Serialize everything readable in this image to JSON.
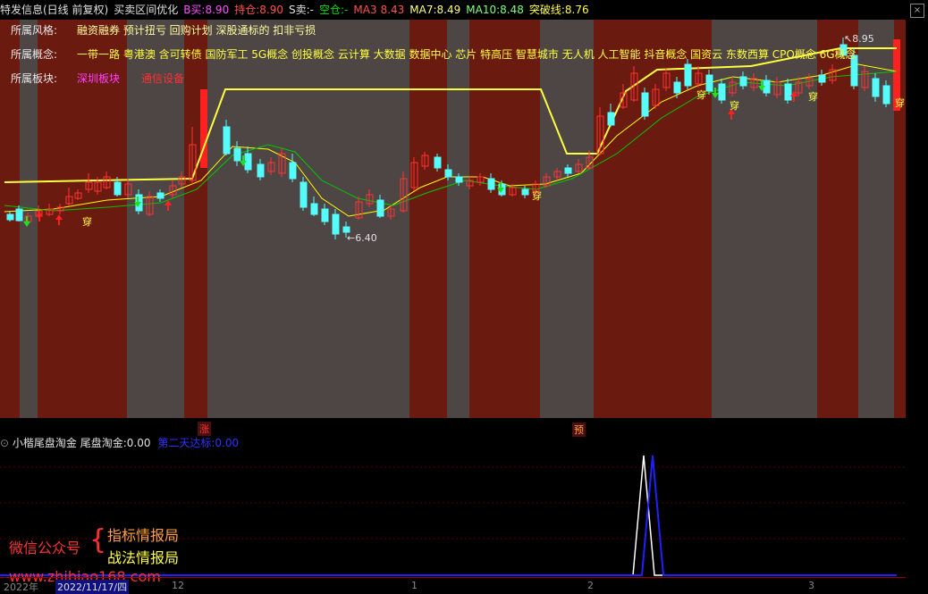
{
  "header": {
    "title": "特发信息(日线 前复权)",
    "indicator": "买卖区间优化",
    "b_buy_label": "B买:",
    "b_buy_value": "8.90",
    "hold_label": "持仓:",
    "hold_value": "8.90",
    "s_sell_label": "S卖:",
    "s_sell_value": "-",
    "empty_label": "空仓:",
    "empty_value": "-",
    "ma3_label": "MA3",
    "ma3_value": "8.43",
    "ma7_label": "MA7:",
    "ma7_value": "8.49",
    "ma10_label": "MA10:",
    "ma10_value": "8.48",
    "breakout_label": "突破线:",
    "breakout_value": "8.76",
    "close_symbol": "×"
  },
  "info": {
    "style_label": "所属风格:",
    "style_value": "融资融券 预计扭亏 回购计划 深股通标的 扣非亏损",
    "concept_label": "所属概念:",
    "concept_value": "一带一路 粤港澳 含可转债 国防军工 5G概念 创投概念 云计算 大数据 数据中心 芯片 特高压 智慧城市 无人机 人工智能 抖音概念 国资云 东数西算 CPO概念 6G概念",
    "sector_label": "所属板块:",
    "sector_value1": "深圳板块",
    "sector_value2": "通信设备"
  },
  "annotations": {
    "high": "8.95",
    "low": "6.40",
    "chuan": "穿",
    "zhang": "涨",
    "yu": "预"
  },
  "sub": {
    "name": "小楷尾盘淘金",
    "t1_label": "尾盘淘金:",
    "t1_value": "0.00",
    "t2_label": "第二天达标:",
    "t2_value": "0.00"
  },
  "watermark": {
    "wechat": "微信公众号",
    "line1": "指标情报局",
    "line2": "战法情报局",
    "url": "www.zhibiao168.com"
  },
  "axis": {
    "year": "2022年",
    "date": "2022/11/17/四",
    "m12": "12",
    "m1": "1",
    "m2": "2",
    "m3": "3"
  },
  "colors": {
    "up": "#ff3232",
    "down": "#54fcfc",
    "ma3": "#ffff00",
    "ma7": "#ffff54",
    "ma10": "#00c800",
    "breakout": "#ffff40",
    "band_red": "#6b1a10",
    "band_gray": "#4e4545"
  }
}
